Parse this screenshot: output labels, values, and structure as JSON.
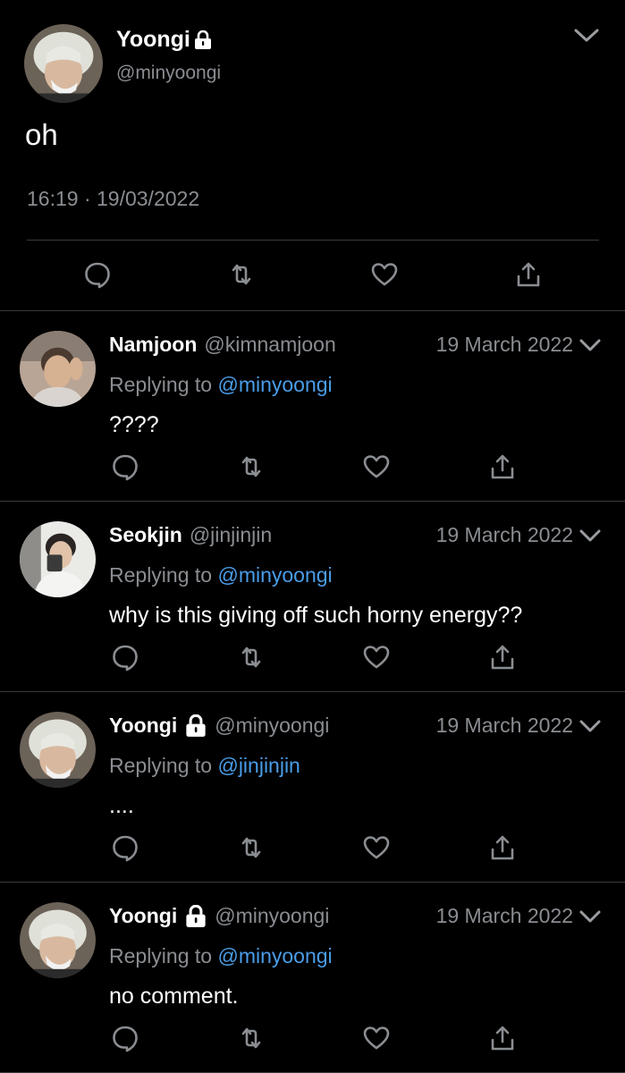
{
  "main_tweet": {
    "name": "Yoongi",
    "handle": "@minyoongi",
    "text": "oh",
    "timestamp": "16:19 · 19/03/2022",
    "actions": [
      "reply-icon",
      "retweet-icon",
      "like-icon",
      "share-icon"
    ]
  },
  "replies": [
    {
      "name": "Namjoon",
      "handle": "@kimnamjoon",
      "locked": false,
      "date": "19 March 2022",
      "replying_prefix": "Replying to ",
      "replying_to": "@minyoongi",
      "text": "????"
    },
    {
      "name": "Seokjin",
      "handle": "@jinjinjin",
      "locked": false,
      "date": "19 March 2022",
      "replying_prefix": "Replying to ",
      "replying_to": "@minyoongi",
      "text": "why is this giving off such horny energy??"
    },
    {
      "name": "Yoongi",
      "handle": "@minyoongi",
      "locked": true,
      "date": "19 March 2022",
      "replying_prefix": "Replying to ",
      "replying_to": "@jinjinjin",
      "text": "...."
    },
    {
      "name": "Yoongi",
      "handle": "@minyoongi",
      "locked": true,
      "date": "19 March 2022",
      "replying_prefix": "Replying to ",
      "replying_to": "@minyoongi",
      "text": "no comment."
    }
  ],
  "colors": {
    "background": "#000000",
    "text": "#ffffff",
    "secondary": "#8a8d91",
    "mention": "#4a9de8",
    "divider": "#3a3a3c"
  }
}
